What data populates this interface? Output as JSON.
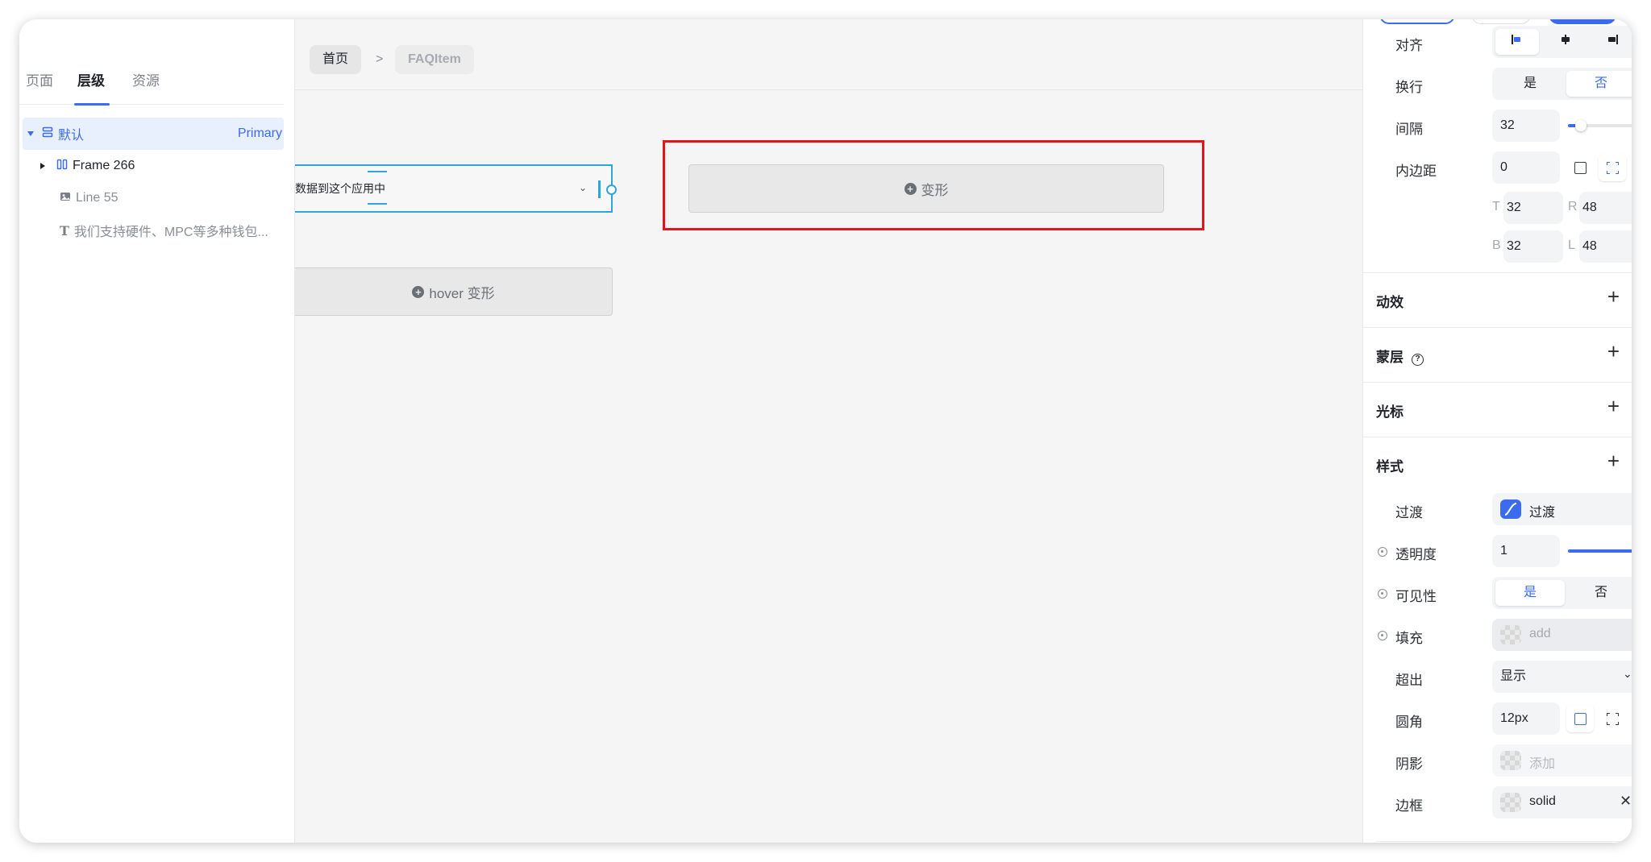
{
  "left_panel": {
    "tabs": [
      {
        "label": "页面"
      },
      {
        "label": "层级"
      },
      {
        "label": "资源"
      }
    ],
    "tree": {
      "root": {
        "label": "默认",
        "tag": "Primary"
      },
      "children": [
        {
          "label": "Frame 266",
          "icon": "frame-icon"
        },
        {
          "label": "Line 55",
          "icon": "image-icon"
        },
        {
          "label": "我们支持硬件、MPC等多种钱包...",
          "icon": "text-icon"
        }
      ]
    }
  },
  "canvas": {
    "breadcrumb": {
      "home": "首页",
      "separator": ">",
      "current": "FAQItem"
    },
    "selected_component_text": "数据到这个应用中",
    "morph_button": "变形",
    "hover_morph_button": "hover 变形"
  },
  "right_panel": {
    "align": {
      "label": "对齐"
    },
    "wrap": {
      "label": "换行",
      "options": [
        "是",
        "否"
      ],
      "selected": "否"
    },
    "gap": {
      "label": "间隔",
      "value": "32",
      "slider_fraction": 0.18
    },
    "padding": {
      "label": "内边距",
      "value": "0",
      "T": "32",
      "R": "48",
      "B": "32",
      "L": "48"
    },
    "sections": [
      "动效",
      "蒙层",
      "光标",
      "样式"
    ],
    "transition": {
      "label": "过渡",
      "value": "过渡"
    },
    "opacity": {
      "label": "透明度",
      "value": "1",
      "slider_fraction": 1.0
    },
    "visibility": {
      "label": "可见性",
      "options": [
        "是",
        "否"
      ],
      "selected": "是"
    },
    "fill": {
      "label": "填充",
      "placeholder": "add"
    },
    "overflow": {
      "label": "超出",
      "value": "显示"
    },
    "radius": {
      "label": "圆角",
      "value": "12px"
    },
    "shadow": {
      "label": "阴影",
      "placeholder": "添加"
    },
    "border": {
      "label": "边框",
      "value": "solid"
    }
  },
  "colors": {
    "accent": "#3b6cf0",
    "highlight": "#e3151b",
    "selection": "#2fa6d8"
  }
}
